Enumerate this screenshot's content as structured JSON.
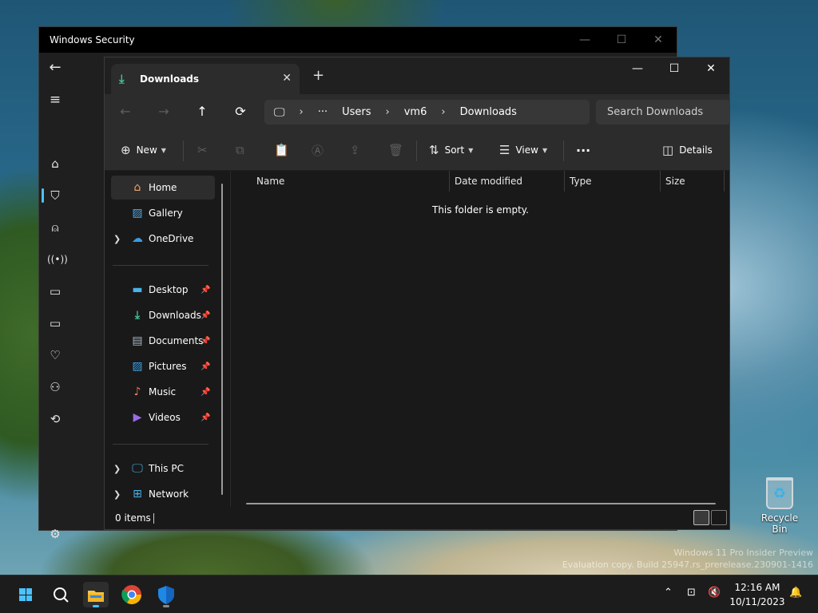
{
  "desktop": {
    "watermark_line1": "Windows 11 Pro Insider Preview",
    "watermark_line2": "Evaluation copy. Build 25947.rs_prerelease.230901-1416",
    "recycle_bin_label": "Recycle Bin"
  },
  "security_window": {
    "title": "Windows Security",
    "controls": {
      "minimize": "—",
      "maximize": "☐",
      "close": "✕"
    }
  },
  "explorer": {
    "tab": {
      "label": "Downloads",
      "close": "✕"
    },
    "new_tab": "+",
    "controls": {
      "minimize": "—",
      "maximize": "☐",
      "close": "✕"
    },
    "nav_buttons": {
      "back": "←",
      "forward": "→",
      "up": "↑",
      "refresh": "⟳"
    },
    "breadcrumb": {
      "more": "···",
      "segments": [
        "Users",
        "vm6",
        "Downloads"
      ],
      "separator": "›"
    },
    "search": {
      "placeholder": "Search Downloads"
    },
    "toolbar": {
      "new_label": "New",
      "sort_label": "Sort",
      "view_label": "View",
      "more_label": "···",
      "details_label": "Details"
    },
    "nav_pane": {
      "top": [
        {
          "label": "Home",
          "icon": "home-icon"
        },
        {
          "label": "Gallery",
          "icon": "gallery-icon"
        },
        {
          "label": "OneDrive",
          "icon": "cloud-icon"
        }
      ],
      "quick_access": [
        {
          "label": "Desktop",
          "icon": "desktop-icon"
        },
        {
          "label": "Downloads",
          "icon": "download-icon"
        },
        {
          "label": "Documents",
          "icon": "document-icon"
        },
        {
          "label": "Pictures",
          "icon": "picture-icon"
        },
        {
          "label": "Music",
          "icon": "music-icon"
        },
        {
          "label": "Videos",
          "icon": "video-icon"
        }
      ],
      "bottom": [
        {
          "label": "This PC",
          "icon": "pc-icon"
        },
        {
          "label": "Network",
          "icon": "network-icon"
        }
      ]
    },
    "columns": [
      "Name",
      "Date modified",
      "Type",
      "Size"
    ],
    "empty_message": "This folder is empty.",
    "status": {
      "item_count": "0 items"
    }
  },
  "taskbar": {
    "time": "12:16 AM",
    "date": "10/11/2023"
  },
  "colors": {
    "accent": "#4cc2ff",
    "explorer_bg": "#191919",
    "toolbar_bg": "#2c2c2c",
    "download_green": "#3fc29b"
  }
}
